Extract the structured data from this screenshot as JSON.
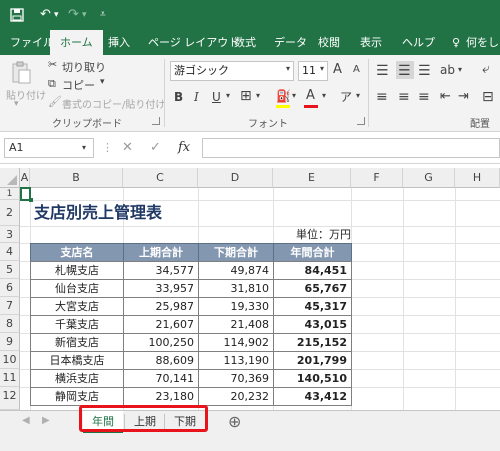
{
  "qat": {
    "save_icon": "save-icon",
    "undo_icon": "undo-icon",
    "redo_icon": "redo-icon",
    "customize_icon": "customize-qat-icon"
  },
  "ribbon_tabs": [
    "ファイル",
    "ホーム",
    "挿入",
    "ページ レイアウト",
    "数式",
    "データ",
    "校閲",
    "表示",
    "ヘルプ",
    "何をしま"
  ],
  "ribbon": {
    "clipboard": {
      "paste": "貼り付け",
      "cut": "切り取り",
      "copy": "コピー",
      "format_painter": "書式のコピー/貼り付け",
      "label": "クリップボード"
    },
    "font": {
      "font_name": "游ゴシック",
      "font_size": "11",
      "bold": "B",
      "italic": "I",
      "underline": "U",
      "label": "フォント",
      "grow": "A",
      "shrink": "A"
    },
    "alignment": {
      "label": "配置"
    }
  },
  "formula_bar": {
    "namebox": "A1",
    "cancel": "✕",
    "enter": "✓",
    "fx": "fx",
    "value": ""
  },
  "columns": [
    "A",
    "B",
    "C",
    "D",
    "E",
    "F",
    "G",
    "H"
  ],
  "rows": [
    "1",
    "2",
    "3",
    "4",
    "5",
    "6",
    "7",
    "8",
    "9",
    "10",
    "11",
    "12"
  ],
  "sheet": {
    "title": "支店別売上管理表",
    "unit": "単位：万円",
    "headers": [
      "支店名",
      "上期合計",
      "下期合計",
      "年間合計"
    ],
    "data": [
      [
        "札幌支店",
        "34,577",
        "49,874",
        "84,451"
      ],
      [
        "仙台支店",
        "33,957",
        "31,810",
        "65,767"
      ],
      [
        "大宮支店",
        "25,987",
        "19,330",
        "45,317"
      ],
      [
        "千葉支店",
        "21,607",
        "21,408",
        "43,015"
      ],
      [
        "新宿支店",
        "100,250",
        "114,902",
        "215,152"
      ],
      [
        "日本橋支店",
        "88,609",
        "113,190",
        "201,799"
      ],
      [
        "横浜支店",
        "70,141",
        "70,369",
        "140,510"
      ],
      [
        "静岡支店",
        "23,180",
        "20,232",
        "43,412"
      ]
    ]
  },
  "sheet_tabs": [
    "年間",
    "上期",
    "下期"
  ],
  "add_sheet": "⊕",
  "colors": {
    "excel_green": "#217346",
    "header_fill": "#8497b0",
    "title_blue": "#1f3864",
    "highlight_red": "#e8141b"
  }
}
